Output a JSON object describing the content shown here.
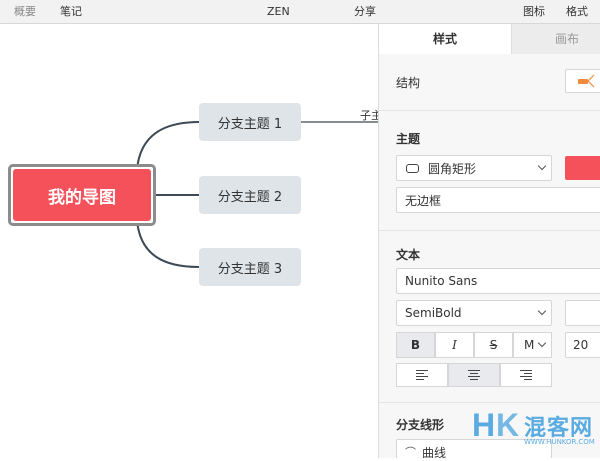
{
  "toolbar": {
    "overview": "概要",
    "notes": "笔记",
    "zen": "ZEN",
    "share": "分享",
    "icons": "图标",
    "format": "格式"
  },
  "mindmap": {
    "root": "我的导图",
    "branches": [
      "分支主题 1",
      "分支主题 2",
      "分支主题 3"
    ],
    "subtopic": "子主",
    "root_color": "#f4515b",
    "branch_color": "#dfe4e8"
  },
  "panel": {
    "tabs": {
      "style": "样式",
      "canvas": "画布"
    },
    "structure_label": "结构",
    "topic": {
      "title": "主题",
      "shape": "圆角矩形",
      "fill_color": "#f4515b",
      "border": "无边框"
    },
    "text": {
      "title": "文本",
      "font": "Nunito Sans",
      "weight": "SemiBold",
      "bold": "B",
      "italic": "I",
      "strike": "S",
      "more": "M",
      "size": "20"
    },
    "branch_line": {
      "title": "分支线形",
      "type": "曲线"
    }
  },
  "brand": {
    "logo_text": "混客网",
    "logo_letters": "HK",
    "url": "WWW.HUNKOR.COM"
  }
}
